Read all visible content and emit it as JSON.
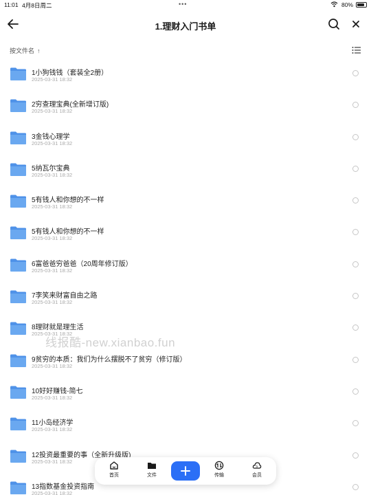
{
  "status": {
    "time": "11:01",
    "date": "4月8日周二",
    "battery": "80%"
  },
  "header": {
    "title": "1.理财入门书单"
  },
  "sort": {
    "label": "按文件名"
  },
  "files": [
    {
      "name": "1小狗钱钱（套装全2册）",
      "date": "2025-03-31 18:32"
    },
    {
      "name": "2穷查理宝典(全新增订版)",
      "date": "2025-03-31 18:32"
    },
    {
      "name": "3金钱心理学",
      "date": "2025-03-31 18:32"
    },
    {
      "name": "5纳瓦尔宝典",
      "date": "2025-03-31 18:32"
    },
    {
      "name": "5有钱人和你想的不一样",
      "date": "2025-03-31 18:32"
    },
    {
      "name": "5有钱人和你想的不一样",
      "date": "2025-03-31 18:32"
    },
    {
      "name": "6富爸爸穷爸爸（20周年修订版）",
      "date": "2025-03-31 18:32"
    },
    {
      "name": "7李笑来财富自由之路",
      "date": "2025-03-31 18:32"
    },
    {
      "name": "8理财就是理生活",
      "date": "2025-03-31 18:32"
    },
    {
      "name": "9贫穷的本质：我们为什么摆脱不了贫穷（修订版）",
      "date": "2025-03-31 18:32"
    },
    {
      "name": "10好好赚钱-简七",
      "date": "2025-03-31 18:32"
    },
    {
      "name": "11小岛经济学",
      "date": "2025-03-31 18:32"
    },
    {
      "name": "12投资最重要的事（全新升级版)",
      "date": "2025-03-31 18:32"
    },
    {
      "name": "13指数基金投资指南",
      "date": "2025-03-31 18:32"
    }
  ],
  "watermark": "线报酷-new.xianbao.fun",
  "tabbar": {
    "home": "首页",
    "files": "文件",
    "transfer": "传输",
    "vip": "会员"
  },
  "colors": {
    "accent": "#2b6ff6",
    "folder": "#6aa8f0"
  },
  "icons": {
    "back": "arrow-left-icon",
    "search": "search-icon",
    "close": "close-icon",
    "view": "list-view-icon",
    "folder": "folder-icon"
  }
}
